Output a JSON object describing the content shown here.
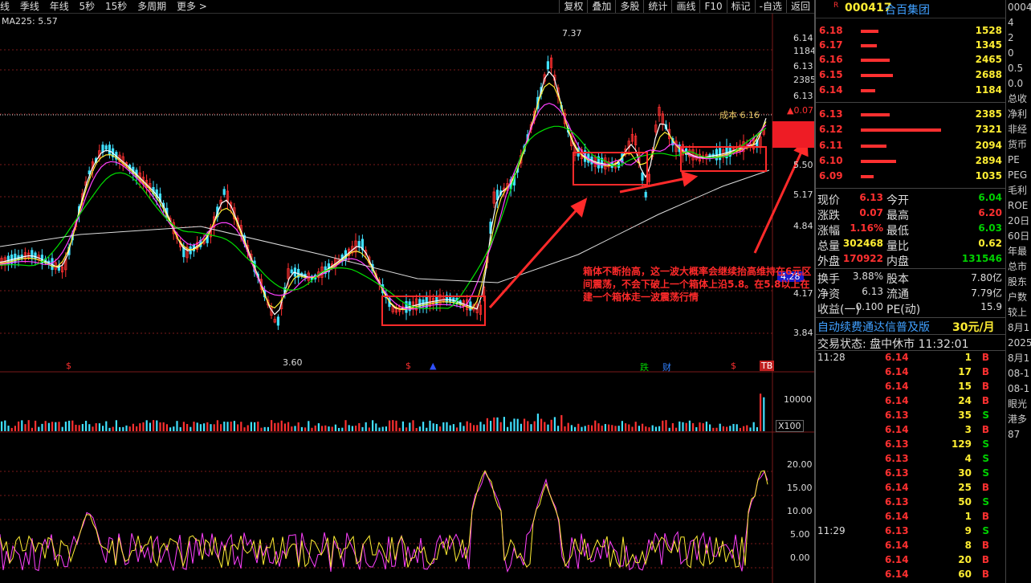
{
  "toolbar": {
    "left_items": [
      "线",
      "季线",
      "年线",
      "5秒",
      "15秒",
      "多周期",
      "更多 >"
    ],
    "right_items": [
      "复权",
      "叠加",
      "多股",
      "统计",
      "画线",
      "F10",
      "标记",
      "-自选",
      "返回"
    ]
  },
  "chart": {
    "ma_label": "MA225: 5.57",
    "price_axis": [
      "6.14",
      "1184",
      "6.13",
      "2385",
      "6.13",
      "▲0.07",
      "5.50",
      "5.17",
      "4.84",
      "4.28",
      "4.17",
      "3.84"
    ],
    "high_marker": "7.37",
    "low_marker": "3.60",
    "cost_label": "成本 6.16",
    "event_badges": [
      "$",
      "$",
      "▲",
      "跌",
      "财",
      "$",
      "TB"
    ],
    "volume_axis": [
      "10000",
      "X100"
    ],
    "osc_axis": [
      "20.00",
      "15.00",
      "10.00",
      "5.00",
      "0.00"
    ],
    "annotation": "箱体不断抬高，这一波大概率会继续抬高维持在6元区间震荡，不会下破上一个箱体上沿5.8。在5.8以上在建一个箱体走一波震荡行情"
  },
  "quote": {
    "badge": "R",
    "code": "000417",
    "name": "合百集团",
    "asks": [
      {
        "price": "6.18",
        "vol": "1528",
        "bar": 0.22
      },
      {
        "price": "6.17",
        "vol": "1345",
        "bar": 0.2
      },
      {
        "price": "6.16",
        "vol": "2465",
        "bar": 0.38
      },
      {
        "price": "6.15",
        "vol": "2688",
        "bar": 0.42
      },
      {
        "price": "6.14",
        "vol": "1184",
        "bar": 0.18
      }
    ],
    "bids": [
      {
        "price": "6.13",
        "vol": "2385",
        "bar": 0.37
      },
      {
        "price": "6.12",
        "vol": "7321",
        "bar": 1.0
      },
      {
        "price": "6.11",
        "vol": "2094",
        "bar": 0.32
      },
      {
        "price": "6.10",
        "vol": "2894",
        "bar": 0.44
      },
      {
        "price": "6.09",
        "vol": "1035",
        "bar": 0.16
      }
    ],
    "stats": [
      {
        "l1": "现价",
        "v1": "6.13",
        "l2": "今开",
        "v2": "6.04",
        "c1": "red",
        "c2": "green"
      },
      {
        "l1": "涨跌",
        "v1": "0.07",
        "l2": "最高",
        "v2": "6.20",
        "c1": "red",
        "c2": "red"
      },
      {
        "l1": "涨幅",
        "v1": "1.16%",
        "l2": "最低",
        "v2": "6.03",
        "c1": "red",
        "c2": "green"
      },
      {
        "l1": "总量",
        "v1": "302468",
        "l2": "量比",
        "v2": "0.62",
        "c1": "yellow",
        "c2": "yellow"
      },
      {
        "l1": "外盘",
        "v1": "170922",
        "l2": "内盘",
        "v2": "131546",
        "c1": "red",
        "c2": "green"
      }
    ],
    "stats2": [
      {
        "l1": "换手",
        "v1": "3.88%",
        "l2": "股本",
        "v2": "7.80亿"
      },
      {
        "l1": "净资",
        "v1": "6.13",
        "l2": "流通",
        "v2": "7.79亿"
      },
      {
        "l1": "收益(一)",
        "v1": "0.100",
        "l2": "PE(动)",
        "v2": "15.9"
      }
    ],
    "promo_text": "自动续费通达信普及版",
    "promo_price": "30元/月",
    "trade_status": "交易状态: 盘中休市 11:32:01",
    "trades": [
      {
        "time": "11:28",
        "price": "6.14",
        "vol": "1",
        "side": "B"
      },
      {
        "time": "",
        "price": "6.14",
        "vol": "17",
        "side": "B"
      },
      {
        "time": "",
        "price": "6.14",
        "vol": "15",
        "side": "B"
      },
      {
        "time": "",
        "price": "6.14",
        "vol": "24",
        "side": "B"
      },
      {
        "time": "",
        "price": "6.13",
        "vol": "35",
        "side": "S"
      },
      {
        "time": "",
        "price": "6.14",
        "vol": "3",
        "side": "B"
      },
      {
        "time": "",
        "price": "6.13",
        "vol": "129",
        "side": "S"
      },
      {
        "time": "",
        "price": "6.13",
        "vol": "4",
        "side": "S"
      },
      {
        "time": "",
        "price": "6.13",
        "vol": "30",
        "side": "S"
      },
      {
        "time": "",
        "price": "6.14",
        "vol": "25",
        "side": "B"
      },
      {
        "time": "",
        "price": "6.13",
        "vol": "50",
        "side": "S"
      },
      {
        "time": "",
        "price": "6.14",
        "vol": "1",
        "side": "B"
      },
      {
        "time": "11:29",
        "price": "6.13",
        "vol": "9",
        "side": "S"
      },
      {
        "time": "",
        "price": "6.14",
        "vol": "8",
        "side": "B"
      },
      {
        "time": "",
        "price": "6.14",
        "vol": "20",
        "side": "B"
      },
      {
        "time": "",
        "price": "6.14",
        "vol": "60",
        "side": "B"
      }
    ]
  },
  "far_panel": [
    "0004",
    "4",
    "2",
    "0",
    "0.5",
    "0.0",
    "总收",
    "净利",
    "非经",
    "货币",
    "PE",
    "PEG",
    "毛利",
    "ROE",
    "20日",
    "60日",
    "年最",
    "总市",
    "股东",
    "户数",
    "较上",
    "8月1",
    "2025",
    "8月1",
    "08-1",
    "08-1",
    "眼光",
    "港多",
    "87"
  ]
}
